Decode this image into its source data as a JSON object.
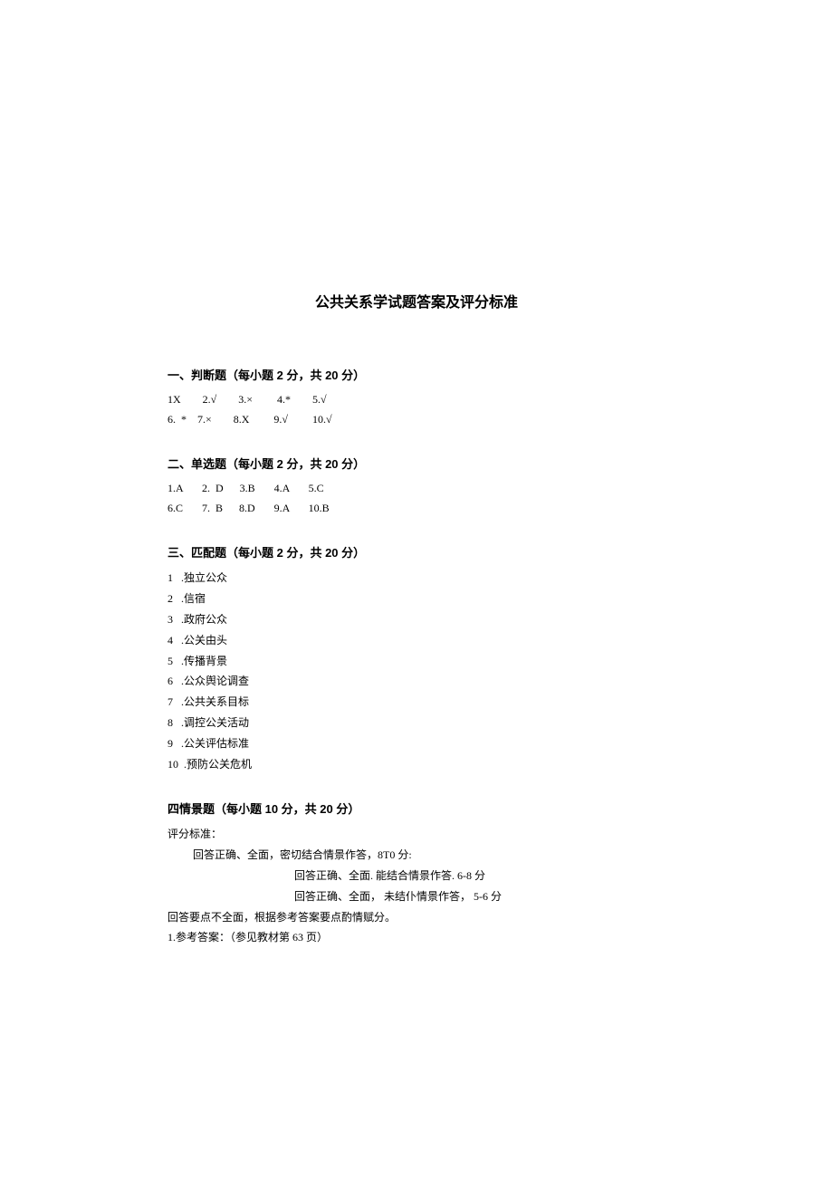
{
  "title": "公共关系学试题答案及评分标准",
  "section1": {
    "header": "一、判断题（每小题 2 分，共 20 分）",
    "row1": "1X        2.√        3.×         4.*        5.√",
    "row2": "6.  *    7.×        8.X         9.√         10.√"
  },
  "section2": {
    "header": "二、单选题（每小题 2 分，共 20 分）",
    "row1": "1.A       2.  D      3.B       4.A       5.C",
    "row2": "6.C       7.  B      8.D       9.A       10.B"
  },
  "section3": {
    "header": "三、匹配题（每小题 2 分，共 20 分）",
    "items": [
      "1   .独立公众",
      "2   .信宿",
      "3   .政府公众",
      "4   .公关由头",
      "5   .传播背景",
      "6   .公众舆论调查",
      "7   .公共关系目标",
      "8   .调控公关活动",
      "9   .公关评估标准",
      "10  .预防公关危机"
    ]
  },
  "section4": {
    "header": "四情景题（每小题 10 分，共 20 分）",
    "line1": "评分标准：",
    "line2": "回答正确、全面，密切结合情景作答，8T0 分:",
    "line3": "回答正确、全面.  能结合情景作答.  6-8 分",
    "line4": "回答正确、全面， 未结仆情景作答， 5-6 分",
    "line5": "回答要点不全面，根据参考答案要点酌情赋分。",
    "line6": "1.参考答案：（参见教材第 63 页）"
  }
}
